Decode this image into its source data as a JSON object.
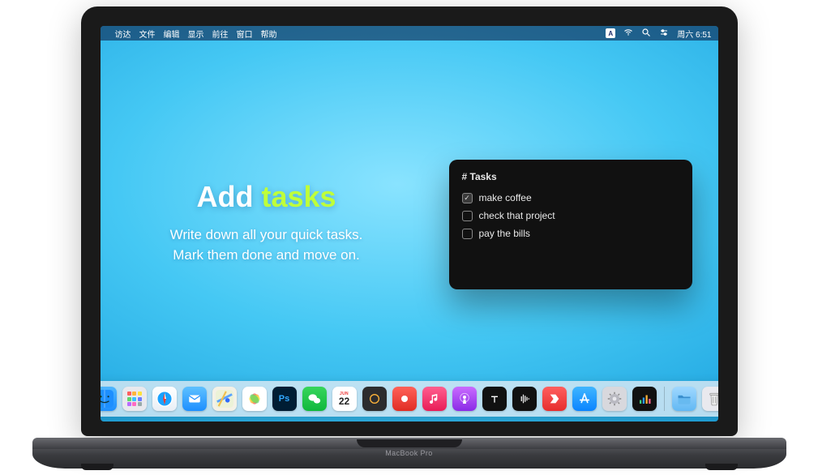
{
  "menubar": {
    "apple_glyph": "",
    "items": [
      "访达",
      "文件",
      "编辑",
      "显示",
      "前往",
      "窗口",
      "帮助"
    ],
    "input_indicator": "A",
    "clock": "周六 6:51"
  },
  "promo": {
    "title_1": "Add ",
    "title_2": "tasks",
    "line1": "Write down all your quick tasks.",
    "line2": "Mark them done and move on."
  },
  "task_window": {
    "title": "# Tasks",
    "items": [
      {
        "label": "make coffee",
        "checked": true
      },
      {
        "label": "check that project",
        "checked": false
      },
      {
        "label": "pay the bills",
        "checked": false
      }
    ]
  },
  "calendar_icon": {
    "month": "JUN",
    "day": "22"
  },
  "dock": {
    "apps": [
      "finder",
      "launchpad",
      "safari",
      "mail",
      "maps",
      "photos",
      "photoshop",
      "wechat",
      "calendar",
      "dark",
      "red",
      "music",
      "podcasts",
      "tv",
      "voice",
      "news",
      "appstore",
      "settings",
      "stocks"
    ],
    "right": [
      "folder",
      "trash"
    ]
  },
  "laptop": {
    "model": "MacBook Pro"
  }
}
